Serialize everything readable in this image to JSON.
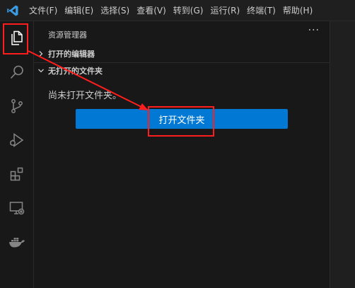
{
  "app": {
    "logo_icon": "vscode-logo-icon"
  },
  "menu": {
    "items": [
      "文件(F)",
      "编辑(E)",
      "选择(S)",
      "查看(V)",
      "转到(G)",
      "运行(R)",
      "终端(T)",
      "帮助(H)"
    ]
  },
  "activity_bar": {
    "icons": [
      "explorer-icon",
      "search-icon",
      "source-control-icon",
      "run-debug-icon",
      "extensions-icon",
      "remote-explorer-icon",
      "docker-icon"
    ]
  },
  "sidebar": {
    "title": "资源管理器",
    "more": "···",
    "sections": [
      {
        "label": "打开的编辑器",
        "collapsed": true
      },
      {
        "label": "无打开的文件夹",
        "collapsed": false
      }
    ],
    "empty_message": "尚未打开文件夹。",
    "open_folder_button": "打开文件夹"
  },
  "colors": {
    "accent": "#0078d4",
    "annotation": "#ff1e1e",
    "logo": "#3b9ce6"
  }
}
